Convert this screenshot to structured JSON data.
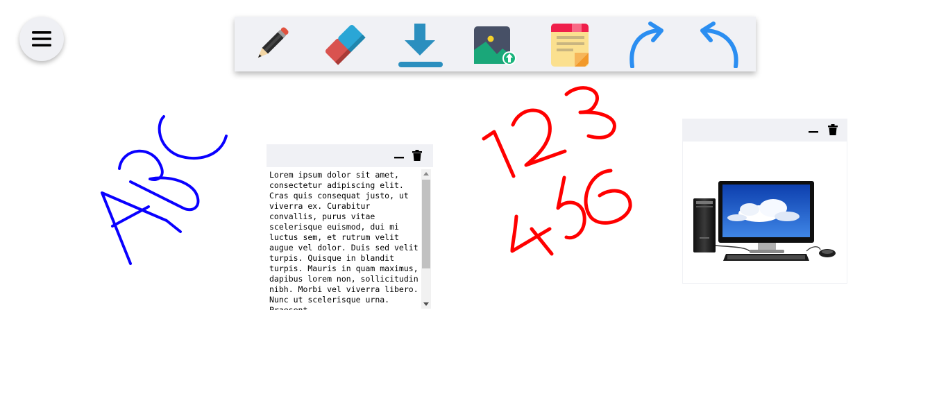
{
  "menu": {
    "icon": "hamburger-icon"
  },
  "toolbar": {
    "tools": [
      {
        "name": "pencil",
        "icon": "pencil-icon"
      },
      {
        "name": "eraser",
        "icon": "eraser-icon"
      },
      {
        "name": "download",
        "icon": "download-icon"
      },
      {
        "name": "upload-image",
        "icon": "image-upload-icon"
      },
      {
        "name": "sticky-note",
        "icon": "sticky-note-icon"
      },
      {
        "name": "redo",
        "icon": "redo-arrow-icon"
      },
      {
        "name": "undo",
        "icon": "undo-arrow-icon"
      }
    ]
  },
  "colors": {
    "blue_ink": "#0a00ff",
    "red_ink": "#ff0000",
    "panel_bg": "#f0f1f5",
    "accent_blue": "#2b8ef1"
  },
  "drawings": [
    {
      "name": "handwriting-abc",
      "text": "ABC",
      "color": "#0a00ff"
    },
    {
      "name": "handwriting-123",
      "text": "123",
      "color": "#ff0000"
    },
    {
      "name": "handwriting-456",
      "text": "456",
      "color": "#ff0000"
    }
  ],
  "note": {
    "text": "Lorem ipsum dolor sit amet, consectetur adipiscing elit. Cras quis consequat justo, ut viverra ex. Curabitur convallis, purus vitae scelerisque euismod, dui mi luctus sem, et rutrum velit augue vel dolor. Duis sed velit turpis. Quisque in blandit turpis. Mauris in quam maximus, dapibus lorem non, sollicitudin nibh. Morbi vel viverra libero. Nunc ut scelerisque urna. Praesent",
    "minimize_icon": "minimize-icon",
    "delete_icon": "trash-icon"
  },
  "image_card": {
    "image": "desktop-computer-image",
    "minimize_icon": "minimize-icon",
    "delete_icon": "trash-icon"
  }
}
